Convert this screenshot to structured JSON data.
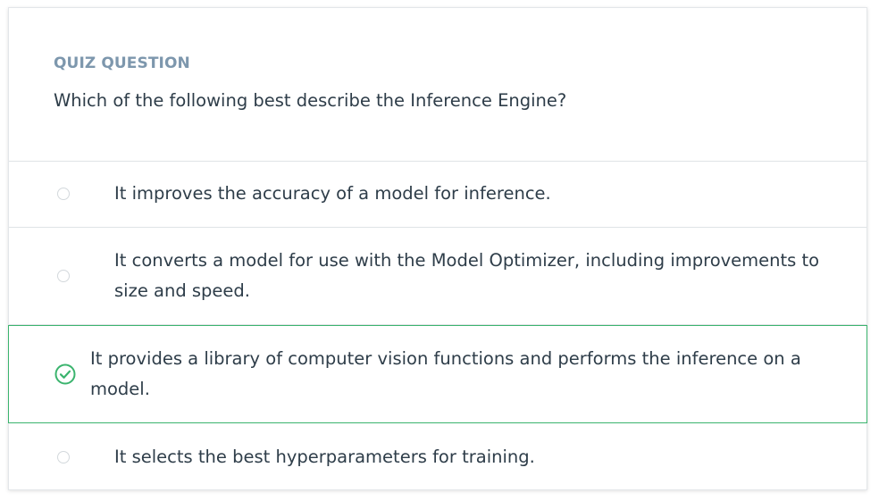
{
  "quiz": {
    "eyebrow": "QUIZ QUESTION",
    "question": "Which of the following best describe the Inference Engine?",
    "options": [
      {
        "label": "It improves the accuracy of a model for inference.",
        "selected": false
      },
      {
        "label": "It converts a model for use with the Model Optimizer, including improvements to size and speed.",
        "selected": false
      },
      {
        "label": "It provides a library of computer vision functions and performs the inference on a model.",
        "selected": true
      },
      {
        "label": "It selects the best hyperparameters for training.",
        "selected": false
      }
    ]
  },
  "colors": {
    "accent_green": "#02b3e4",
    "selected_border": "#3bb46e",
    "eyebrow_text": "#7d97ad",
    "body_text": "#2e3d49"
  },
  "icons": {
    "selected": "check-circle-icon",
    "unselected": "radio-empty-icon"
  }
}
